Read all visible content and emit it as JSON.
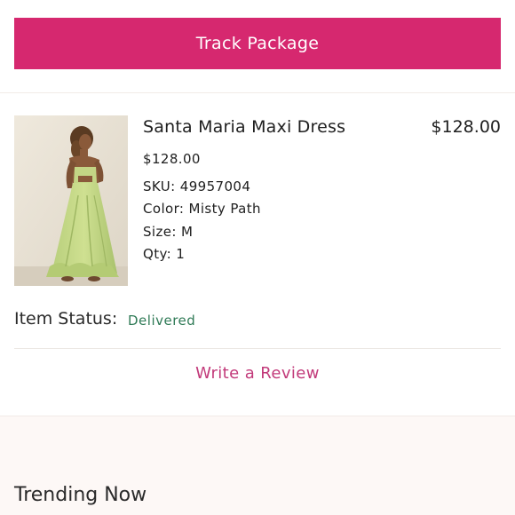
{
  "actions": {
    "track_label": "Track Package"
  },
  "item": {
    "name": "Santa Maria Maxi Dress",
    "total_price": "$128.00",
    "unit_price": "$128.00",
    "sku": "SKU: 49957004",
    "color": "Color: Misty Path",
    "size": "Size: M",
    "qty": "Qty: 1"
  },
  "status": {
    "label": "Item Status:",
    "value": "Delivered"
  },
  "review": {
    "label": "Write a Review"
  },
  "trending": {
    "title": "Trending Now"
  },
  "colors": {
    "accent": "#d6286f",
    "link": "#c23a7a",
    "status_delivered": "#2f7a56"
  }
}
